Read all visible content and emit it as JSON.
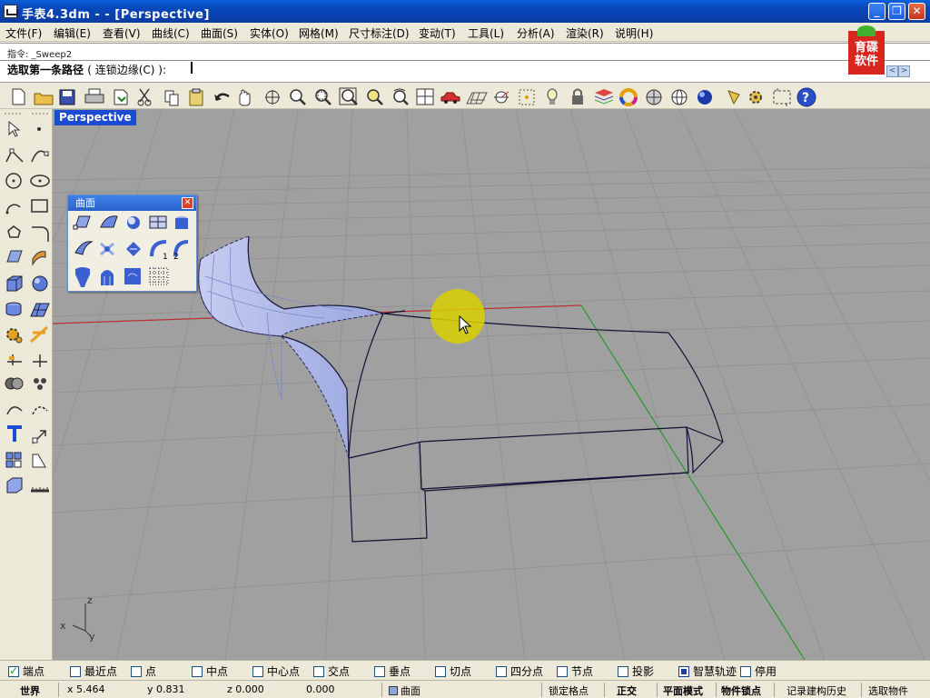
{
  "window": {
    "title": "手表4.3dm -  - [Perspective]"
  },
  "menu": [
    "文件(F)",
    "编辑(E)",
    "查看(V)",
    "曲线(C)",
    "曲面(S)",
    "实体(O)",
    "网格(M)",
    "尺寸标注(D)",
    "变动(T)",
    "工具(L)",
    "分析(A)",
    "渲染(R)",
    "说明(H)"
  ],
  "command": {
    "history": "指令: _Sweep2",
    "prompt": "选取第一条路径",
    "option": "( 连锁边缘(C) ):"
  },
  "logo": {
    "text": "育碟软件"
  },
  "toolbar": {
    "icons": [
      "new-icon",
      "open-icon",
      "save-icon",
      "print-icon",
      "import-icon",
      "cut-icon",
      "copy-icon",
      "paste-icon",
      "undo-icon",
      "pan-icon",
      "rotate-icon",
      "zoom-icon",
      "zoom-window-icon",
      "zoom-extents-icon",
      "zoom-selected-icon",
      "zoom-dynamic-icon",
      "four-view-icon",
      "car-icon",
      "grid-icon",
      "osnap-icon",
      "points-icon",
      "light-icon",
      "lock-icon",
      "layer-icon",
      "color-wheel-icon",
      "shade-icon",
      "wireframe-icon",
      "render-icon",
      "properties-icon",
      "options-icon",
      "grid-snap-icon",
      "help-icon"
    ]
  },
  "viewport": {
    "label": "Perspective"
  },
  "axis": {
    "z": "z",
    "x": "x",
    "y": "y"
  },
  "surface_panel": {
    "title": "曲面",
    "icons": [
      "corner-points-surface-icon",
      "edge-curves-surface-icon",
      "sphere-surface-icon",
      "rectangle-surface-icon",
      "extrude-surface-icon",
      "loft-icon",
      "network-icon",
      "patch-icon",
      "sweep1-icon",
      "sweep2-icon",
      "revolve-icon",
      "rail-revolve-icon",
      "blend-icon",
      "control-points-grid-icon"
    ]
  },
  "osnaps": [
    {
      "label": "端点",
      "checked": true
    },
    {
      "label": "最近点",
      "checked": false
    },
    {
      "label": "点",
      "checked": false
    },
    {
      "label": "中点",
      "checked": false
    },
    {
      "label": "中心点",
      "checked": false
    },
    {
      "label": "交点",
      "checked": false
    },
    {
      "label": "垂点",
      "checked": false
    },
    {
      "label": "切点",
      "checked": false
    },
    {
      "label": "四分点",
      "checked": false
    },
    {
      "label": "节点",
      "checked": false
    },
    {
      "label": "投影",
      "checked": false
    },
    {
      "label": "智慧轨迹",
      "checked": true
    },
    {
      "label": "停用",
      "checked": false
    }
  ],
  "status": {
    "coord_system": "世界",
    "x": "x 5.464",
    "y": "y 0.831",
    "z": "z 0.000",
    "distance": "0.000",
    "layer": "曲面",
    "grid_snap": "锁定格点",
    "ortho": "正交",
    "planar": "平面模式",
    "osnap": "物件锁点",
    "history": "记录建构历史",
    "filter": "选取物件"
  },
  "colors": {
    "x_axis": "#b83030",
    "y_axis": "#2a9a2a",
    "surface": "#b7c0ea",
    "cursor_highlight": "#d9d000"
  }
}
